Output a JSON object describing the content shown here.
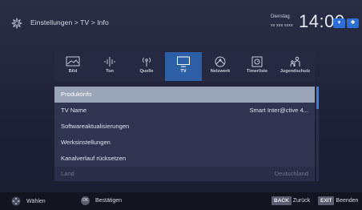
{
  "header": {
    "breadcrumb": "Einstellungen > TV > Info",
    "day": "Dienstag",
    "date": "xx xxx xxxx",
    "time": "14:00",
    "chip_down": "▾",
    "chip_bt": "✱"
  },
  "tabs": [
    {
      "label": "Bild",
      "icon": "picture-icon",
      "active": false
    },
    {
      "label": "Ton",
      "icon": "sound-icon",
      "active": false
    },
    {
      "label": "Quelle",
      "icon": "source-icon",
      "active": false
    },
    {
      "label": "TV",
      "icon": "tv-icon",
      "active": true
    },
    {
      "label": "Netzwerk",
      "icon": "network-icon",
      "active": false
    },
    {
      "label": "Timerliste",
      "icon": "timer-icon",
      "active": false
    },
    {
      "label": "Jugendschutz",
      "icon": "parental-icon",
      "active": false
    }
  ],
  "menu": [
    {
      "label": "Produktinfo",
      "value": "",
      "state": "selected"
    },
    {
      "label": "TV Name",
      "value": "Smart Inter@ctive 4...",
      "state": "normal"
    },
    {
      "label": "Softwareaktualisierungen",
      "value": "",
      "state": "normal"
    },
    {
      "label": "Werksinstellungen",
      "value": "",
      "state": "normal"
    },
    {
      "label": "Kanalverlauf rücksetzen",
      "value": "",
      "state": "normal"
    },
    {
      "label": "Land",
      "value": "Deutschland",
      "state": "dim"
    }
  ],
  "footer": {
    "select_label": "Wählen",
    "ok_key": "OK",
    "confirm_label": "Bestätigen",
    "back_key": "BACK",
    "back_label": "Zurück",
    "exit_key": "EXIT",
    "exit_label": "Beenden"
  },
  "colors": {
    "accent": "#2c5fa5",
    "background": "#1d2036",
    "selected_row": "#9aa4b8"
  }
}
